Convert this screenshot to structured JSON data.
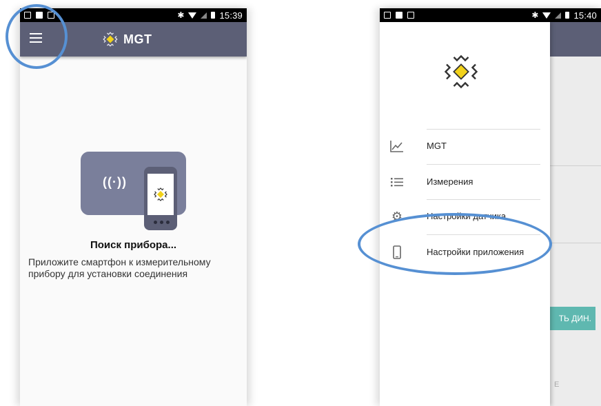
{
  "left_screen": {
    "status_bar": {
      "time": "15:39"
    },
    "toolbar": {
      "title": "MGT",
      "menu_icon": "hamburger-menu-icon"
    },
    "main": {
      "waves_glyph": "((·))",
      "title": "Поиск прибора...",
      "description": "Приложите смартфон к измерительному прибору для установки соединения"
    }
  },
  "right_screen": {
    "status_bar": {
      "time": "15:40"
    },
    "drawer": {
      "items": [
        {
          "label": "MGT",
          "icon": "chart-icon"
        },
        {
          "label": "Измерения",
          "icon": "list-icon"
        },
        {
          "label": "Настройки датчика",
          "icon": "gear-icon"
        },
        {
          "label": "Настройки приложения",
          "icon": "phone-icon"
        }
      ]
    },
    "background": {
      "button_label": "ТЬ ДИН.",
      "tail_text": "E"
    }
  },
  "colors": {
    "toolbar": "#5c5f76",
    "highlight": "#5690d3",
    "accent_yellow": "#f2d21b",
    "teal_button": "#5fb8b0"
  }
}
